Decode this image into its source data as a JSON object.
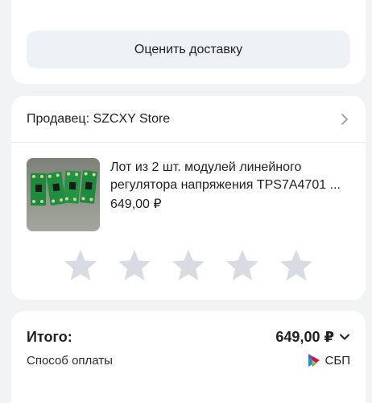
{
  "delivery": {
    "rate_button_label": "Оценить доставку"
  },
  "seller": {
    "label": "Продавец: SZCXY Store"
  },
  "product": {
    "title": "Лот из 2 шт. модулей линейного регулятора напряжения TPS7A4701 ...",
    "price": "649,00 ₽"
  },
  "rating": {
    "max_stars": 5,
    "selected": 0,
    "star_color": "#d8dbe1"
  },
  "summary": {
    "total_label": "Итого:",
    "total_value": "649,00 ₽",
    "payment_label": "Способ оплаты",
    "payment_method": "СБП"
  },
  "icons": {
    "seller_chevron": "chevron-right-icon",
    "total_chevron": "chevron-down-icon",
    "payment_logo": "sbp-logo-icon",
    "star": "star-icon"
  }
}
